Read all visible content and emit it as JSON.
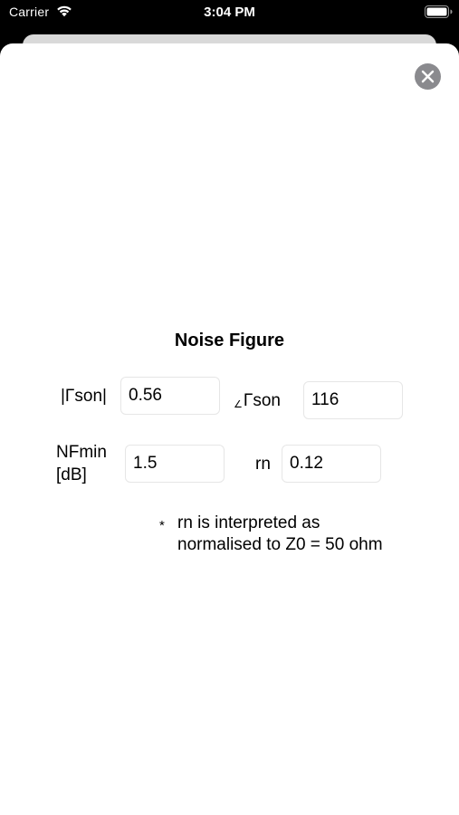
{
  "status_bar": {
    "carrier": "Carrier",
    "time": "3:04 PM",
    "wifi_icon": "wifi-icon",
    "battery_icon": "battery-icon"
  },
  "sheet": {
    "close_icon": "close-icon",
    "title": "Noise Figure",
    "gamma_mag": {
      "label": "|Γson|",
      "value": "0.56"
    },
    "gamma_angle": {
      "label_symbol": "∠",
      "label": "Γson",
      "value": "116"
    },
    "nfmin": {
      "label_line1": "NFmin",
      "label_line2": "[dB]",
      "value": "1.5"
    },
    "rn": {
      "label": "rn",
      "value": "0.12"
    },
    "note": {
      "bullet": "*",
      "line1": "rn is interpreted as",
      "line2": "normalised to Z0 = 50 ohm"
    }
  },
  "colors": {
    "background": "#000000",
    "sheet": "#ffffff",
    "close_button": "#8a8a8e",
    "field_border": "#e6e6e6"
  }
}
